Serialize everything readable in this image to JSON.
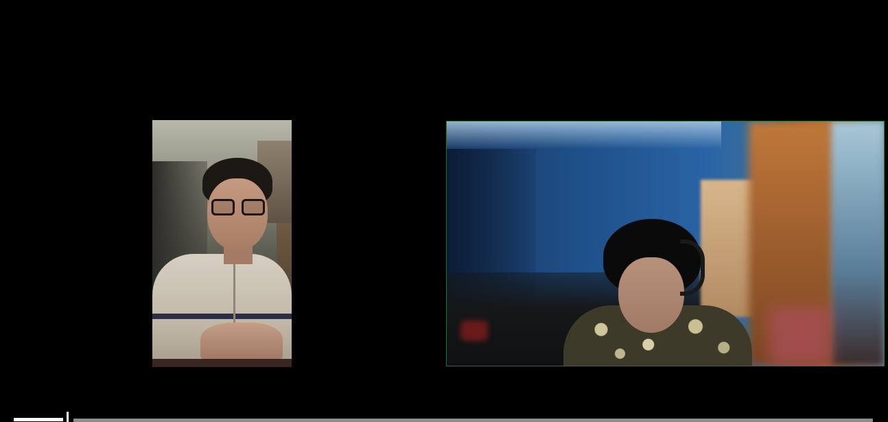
{
  "app": {
    "type": "video-call-recording-player"
  },
  "participants": [
    {
      "tile": "participant-left",
      "orientation": "portrait",
      "active_speaker": false
    },
    {
      "tile": "participant-right",
      "orientation": "landscape",
      "active_speaker": true,
      "highlight_color": "#2e6b3e"
    }
  ],
  "player": {
    "progress_fraction": 0.066,
    "played_color": "#ffffff",
    "track_color": "#8e8e8e"
  },
  "colors": {
    "background": "#000000"
  }
}
